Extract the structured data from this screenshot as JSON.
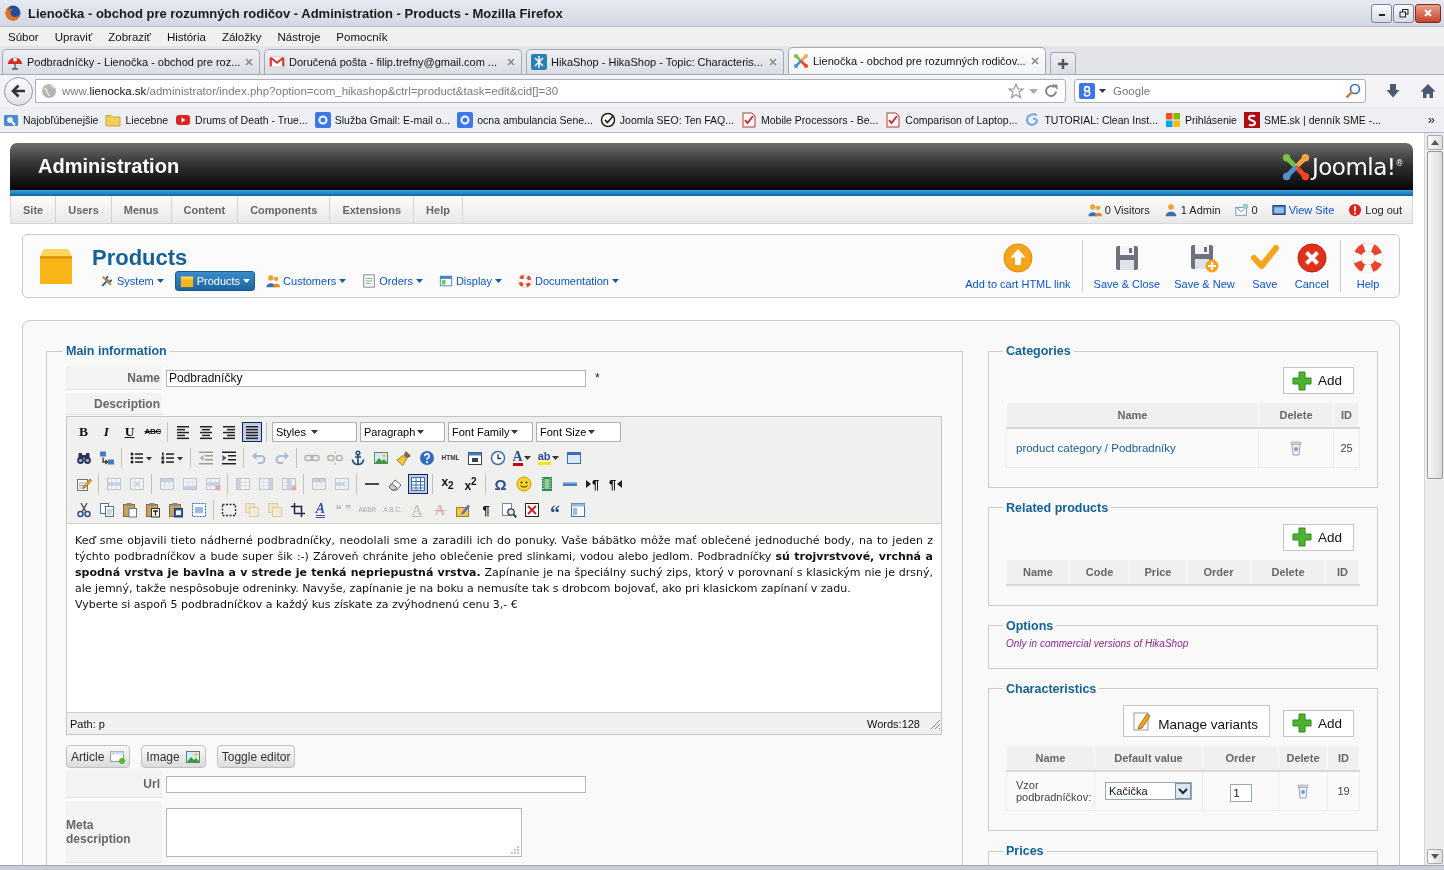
{
  "window": {
    "title": "Lienočka - obchod pre rozumných rodičov - Administration - Products - Mozilla Firefox"
  },
  "menu_bar": [
    "Súbor",
    "Upraviť",
    "Zobraziť",
    "História",
    "Záložky",
    "Nástroje",
    "Pomocník"
  ],
  "tabs": [
    {
      "kind": "shop",
      "title": "Podbradníčky - Lienočka - obchod pre roz...",
      "selected": false
    },
    {
      "kind": "mail",
      "title": "Doručená pošta - filip.trefny@gmail.com ...",
      "selected": false
    },
    {
      "kind": "forum",
      "title": "HikaShop - HikaShop - Topic: Characteris...",
      "selected": false
    },
    {
      "kind": "joomla",
      "title": "Lienočka - obchod pre rozumných rodičov...",
      "selected": true
    }
  ],
  "address_bar": {
    "prefix": "www.",
    "domain": "lienocka.sk",
    "path": "/administrator/index.php?option=com_hikashop&ctrl=product&task=edit&cid[]=30"
  },
  "search_bar": {
    "placeholder": "Google"
  },
  "bookmarks": [
    {
      "kind": "smart",
      "label": "Najobľúbenejšie"
    },
    {
      "kind": "folder",
      "label": "Liecebne"
    },
    {
      "kind": "video",
      "label": "Drums of Death - True..."
    },
    {
      "kind": "g",
      "label": "Služba Gmail: E-mail o..."
    },
    {
      "kind": "g",
      "label": "ocna ambulancia Sene..."
    },
    {
      "kind": "check",
      "label": "Joomla SEO: Ten FAQ..."
    },
    {
      "kind": "review",
      "label": "Mobile Processors - Be..."
    },
    {
      "kind": "review",
      "label": "Comparison of Laptop..."
    },
    {
      "kind": "swirl",
      "label": "TUTORIAL: Clean Inst..."
    },
    {
      "kind": "windows",
      "label": "Prihlásenie"
    },
    {
      "kind": "news",
      "label": "SME.sk | denník SME -..."
    }
  ],
  "bookmarks_more": "»",
  "admin_header": {
    "title": "Administration",
    "logo": "Joomla!$^{®}$"
  },
  "admin_menu": [
    "Site",
    "Users",
    "Menus",
    "Content",
    "Components",
    "Extensions",
    "Help"
  ],
  "admin_status": [
    {
      "kind": "visitors",
      "label": "0 Visitors"
    },
    {
      "kind": "admins",
      "label": "1 Admin"
    },
    {
      "kind": "messages",
      "label": "0"
    },
    {
      "kind": "site",
      "label": "View Site"
    },
    {
      "kind": "logout",
      "label": "Log out"
    }
  ],
  "page_title": "Products",
  "submenu": [
    {
      "kind": "tools",
      "label": "System",
      "selected": false
    },
    {
      "kind": "box",
      "label": "Products",
      "selected": true
    },
    {
      "kind": "users",
      "label": "Customers",
      "selected": false
    },
    {
      "kind": "orders",
      "label": "Orders",
      "selected": false
    },
    {
      "kind": "display",
      "label": "Display",
      "selected": false
    },
    {
      "kind": "lifebuoy",
      "label": "Documentation",
      "selected": false
    }
  ],
  "toolbar": [
    [
      {
        "kind": "add-cart",
        "label": "Add to cart HTML link"
      }
    ],
    [
      {
        "kind": "save-close",
        "label": "Save & Close"
      },
      {
        "kind": "save-new",
        "label": "Save & New"
      },
      {
        "kind": "save",
        "label": "Save"
      },
      {
        "kind": "cancel",
        "label": "Cancel"
      }
    ],
    [
      {
        "kind": "help",
        "label": "Help"
      }
    ]
  ],
  "main_information": {
    "legend": "Main information",
    "name_field": {
      "label": "Name",
      "value": "Podbradníčky",
      "required_mark": "*"
    },
    "description_label": "Description",
    "editor": {
      "toolbar_rows": [
        {
          "groups": [
            [
              {
                "kind": "bold",
                "label": "B",
                "selected": false,
                "disabled": false
              },
              {
                "kind": "italic",
                "label": "I",
                "selected": false,
                "disabled": false
              },
              {
                "kind": "underline",
                "label": "U",
                "selected": false,
                "disabled": false
              },
              {
                "kind": "strikethrough",
                "label": "ABC",
                "selected": false,
                "disabled": false
              }
            ],
            [
              {
                "kind": "alignleft",
                "selected": false,
                "disabled": false
              },
              {
                "kind": "aligncenter",
                "selected": false,
                "disabled": false
              },
              {
                "kind": "alignright",
                "selected": false,
                "disabled": false
              },
              {
                "kind": "alignjustify",
                "selected": true,
                "disabled": false
              }
            ]
          ],
          "selects": [
            "Styles",
            "Paragraph",
            "Font Family",
            "Font Size"
          ]
        },
        {
          "groups": [
            [
              {
                "kind": "find",
                "selected": false,
                "disabled": false
              },
              {
                "kind": "replace",
                "selected": false,
                "disabled": false
              }
            ],
            [
              {
                "kind": "bullist",
                "selected": false,
                "disabled": false
              },
              {
                "kind": "numlist",
                "selected": false,
                "disabled": false
              }
            ],
            [
              {
                "kind": "outdent",
                "selected": false,
                "disabled": true
              },
              {
                "kind": "indent",
                "selected": false,
                "disabled": false
              }
            ],
            [
              {
                "kind": "undo",
                "selected": false,
                "disabled": true
              },
              {
                "kind": "redo",
                "selected": false,
                "disabled": true
              }
            ],
            [
              {
                "kind": "link",
                "selected": false,
                "disabled": true
              },
              {
                "kind": "unlink",
                "selected": false,
                "disabled": true
              },
              {
                "kind": "anchor",
                "selected": false,
                "disabled": false
              },
              {
                "kind": "image",
                "selected": false,
                "disabled": false
              },
              {
                "kind": "cleanup",
                "selected": false,
                "disabled": false
              },
              {
                "kind": "help",
                "selected": false,
                "disabled": false
              },
              {
                "kind": "html",
                "label": "HTML",
                "selected": false,
                "disabled": false
              },
              {
                "kind": "date",
                "selected": false,
                "disabled": false
              },
              {
                "kind": "time",
                "selected": false,
                "disabled": false
              },
              {
                "kind": "forecolor",
                "label": "A",
                "selected": false,
                "disabled": false
              },
              {
                "kind": "backcolor",
                "label": "ab",
                "selected": false,
                "disabled": false
              },
              {
                "kind": "code",
                "selected": false,
                "disabled": false
              }
            ]
          ]
        },
        {
          "groups": [
            [
              {
                "kind": "editpage",
                "selected": false,
                "disabled": false
              }
            ],
            [
              {
                "kind": "rowprops",
                "selected": false,
                "disabled": true
              },
              {
                "kind": "cellprops",
                "selected": false,
                "disabled": true
              }
            ],
            [
              {
                "kind": "rowbefore",
                "selected": false,
                "disabled": true
              },
              {
                "kind": "rowafter",
                "selected": false,
                "disabled": true
              },
              {
                "kind": "deleterow",
                "selected": false,
                "disabled": true
              }
            ],
            [
              {
                "kind": "colbefore",
                "selected": false,
                "disabled": true
              },
              {
                "kind": "colafter",
                "selected": false,
                "disabled": true
              },
              {
                "kind": "deletecol",
                "selected": false,
                "disabled": true
              }
            ],
            [
              {
                "kind": "split",
                "selected": false,
                "disabled": true
              },
              {
                "kind": "merge",
                "selected": false,
                "disabled": true
              }
            ],
            [
              {
                "kind": "hr",
                "selected": false,
                "disabled": false
              },
              {
                "kind": "removeformat",
                "selected": false,
                "disabled": false
              },
              {
                "kind": "visualaid",
                "selected": true,
                "disabled": false
              }
            ],
            [
              {
                "kind": "sub",
                "label": "x$_{2}$",
                "selected": false,
                "disabled": false
              },
              {
                "kind": "sup",
                "label": "x$^{2}$",
                "selected": false,
                "disabled": false
              }
            ],
            [
              {
                "kind": "charmap",
                "label": "Ω",
                "selected": false,
                "disabled": false
              },
              {
                "kind": "emotions",
                "selected": false,
                "disabled": false
              },
              {
                "kind": "media",
                "selected": false,
                "disabled": false
              },
              {
                "kind": "advhr",
                "selected": false,
                "disabled": false
              },
              {
                "kind": "ltr",
                "label": "¶",
                "selected": false,
                "disabled": false
              },
              {
                "kind": "rtl",
                "label": "¶",
                "selected": false,
                "disabled": false
              }
            ]
          ]
        },
        {
          "groups": [
            [
              {
                "kind": "cut",
                "selected": false,
                "disabled": false
              },
              {
                "kind": "copy",
                "selected": false,
                "disabled": false
              },
              {
                "kind": "paste",
                "selected": false,
                "disabled": false
              },
              {
                "kind": "pastetext",
                "selected": false,
                "disabled": false
              },
              {
                "kind": "pasteword",
                "selected": false,
                "disabled": false
              },
              {
                "kind": "selectall",
                "selected": false,
                "disabled": false
              }
            ],
            [
              {
                "kind": "insertlayer",
                "selected": false,
                "disabled": false
              },
              {
                "kind": "forward",
                "selected": false,
                "disabled": true
              },
              {
                "kind": "backward",
                "selected": false,
                "disabled": true
              },
              {
                "kind": "absolute",
                "selected": false,
                "disabled": false
              },
              {
                "kind": "styleprops",
                "label": "A",
                "selected": false,
                "disabled": false
              },
              {
                "kind": "cite",
                "label": "“ ”",
                "selected": false,
                "disabled": true
              },
              {
                "kind": "abbr",
                "label": "ABBR",
                "selected": false,
                "disabled": true
              },
              {
                "kind": "acronym",
                "label": "A.B.C.",
                "selected": false,
                "disabled": true
              },
              {
                "kind": "ins",
                "label": "A",
                "selected": false,
                "disabled": true
              },
              {
                "kind": "del",
                "label": "A",
                "selected": false,
                "disabled": true
              },
              {
                "kind": "attribs",
                "selected": false,
                "disabled": false
              },
              {
                "kind": "visualchars",
                "label": "¶",
                "selected": false,
                "disabled": false
              },
              {
                "kind": "preview",
                "selected": false,
                "disabled": false
              },
              {
                "kind": "pagebreak",
                "selected": false,
                "disabled": false
              },
              {
                "kind": "blockquote",
                "label": "“",
                "selected": false,
                "disabled": false
              },
              {
                "kind": "template",
                "selected": false,
                "disabled": false
              }
            ]
          ]
        }
      ],
      "paragraphs": [
        "Keď sme objavili tieto nádherné podbradníčky, neodolali sme a zaradili ich do ponuky. Vaše bábätko môže mať oblečené jednoduché body, na to jeden z týchto podbradníčkov a bude super šik :-) Zároveň chránite jeho oblečenie pred slinkami, vodou alebo jedlom. Podbradníčky **sú trojvrstvové, vrchná a spodná vrstva je bavlna a v strede je tenká nepriepustná vrstva.** Zapínanie je na špeciálny suchý zips, ktorý v porovnaní s klasickým nie je drsný, ale jemný, takže nespôsobuje odreninky. Navyše, zapínanie je na boku a nemusíte tak s drobcom bojovať, ako pri klasickom zapínaní v zadu.",
        "Vyberte si aspoň 5 podbradníčkov a každý kus získate za zvýhodnenú cenu 3,- €"
      ],
      "path": "Path: p",
      "word_count": "Words:128"
    },
    "editor_buttons": [
      {
        "kind": "article",
        "label": "Article"
      },
      {
        "kind": "image",
        "label": "Image"
      },
      {
        "kind": "toggle",
        "label": "Toggle editor"
      }
    ],
    "url_field": {
      "label": "Url"
    },
    "meta_description_field": {
      "label": "Meta description"
    }
  },
  "categories": {
    "legend": "Categories",
    "add_button": "Add",
    "columns": [
      "Name",
      "Delete",
      "ID"
    ],
    "rows": [
      {
        "name": "product category / Podbradníky",
        "id": "25"
      }
    ]
  },
  "related_products": {
    "legend": "Related products",
    "add_button": "Add",
    "columns": [
      "Name",
      "Code",
      "Price",
      "Order",
      "Delete",
      "ID"
    ]
  },
  "options": {
    "legend": "Options",
    "note": "Only in commercial versions of HikaShop"
  },
  "characteristics": {
    "legend": "Characteristics",
    "buttons": [
      {
        "kind": "edit",
        "label": "Manage variants"
      },
      {
        "kind": "add",
        "label": "Add"
      }
    ],
    "columns": [
      "Name",
      "Default value",
      "Order",
      "Delete",
      "ID"
    ],
    "rows": [
      {
        "name": "Vzor podbradníčkov:",
        "default_value": "Kačička",
        "order": "1",
        "id": "19"
      }
    ]
  },
  "prices": {
    "legend": "Prices"
  }
}
